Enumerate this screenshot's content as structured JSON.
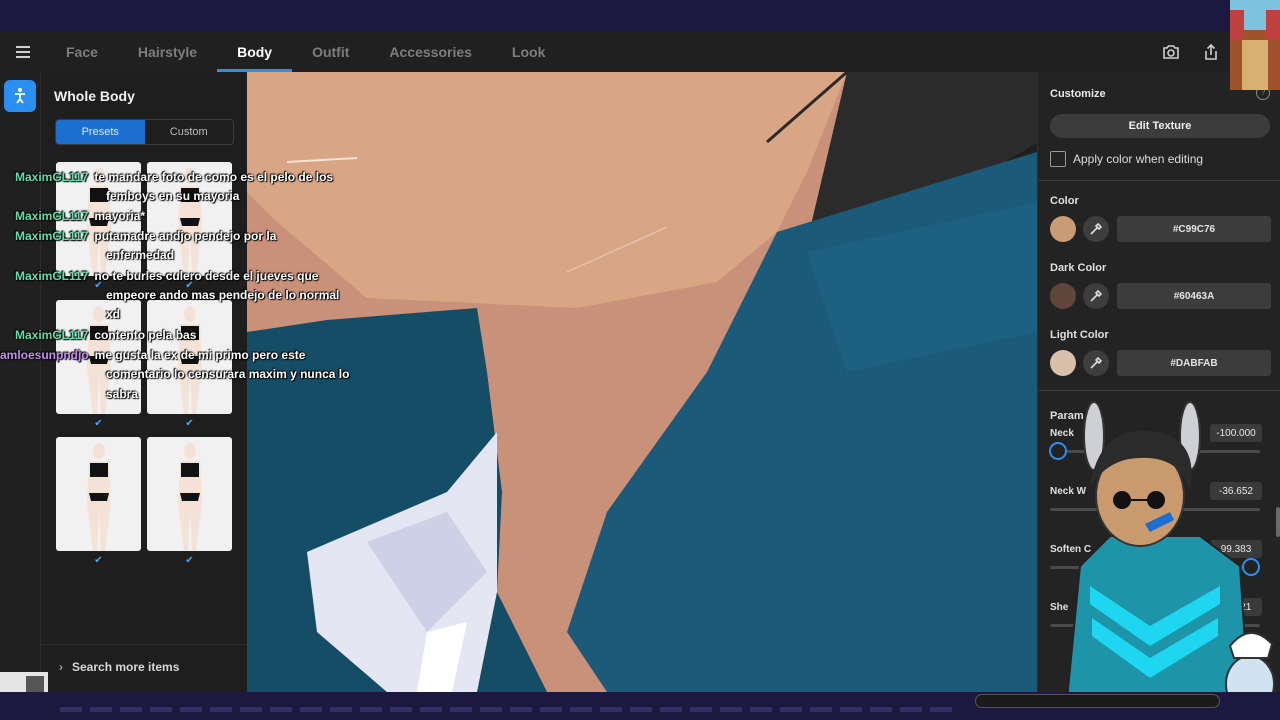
{
  "nav": {
    "tabs": [
      {
        "label": "Face",
        "active": false
      },
      {
        "label": "Hairstyle",
        "active": false
      },
      {
        "label": "Body",
        "active": true
      },
      {
        "label": "Outfit",
        "active": false
      },
      {
        "label": "Accessories",
        "active": false
      },
      {
        "label": "Look",
        "active": false
      }
    ],
    "icons": [
      "menu-icon",
      "camera-icon",
      "share-icon"
    ]
  },
  "left_panel": {
    "title": "Whole Body",
    "segments": [
      "Presets",
      "Custom"
    ],
    "active_segment": "Presets",
    "presets_count": 6,
    "search_more": "Search more items"
  },
  "right_panel": {
    "customize_title": "Customize",
    "edit_texture": "Edit Texture",
    "apply_color_label": "Apply color when editing",
    "apply_color_checked": false,
    "colors": [
      {
        "label": "Color",
        "hex": "#C99C76"
      },
      {
        "label": "Dark Color",
        "hex": "#60463A"
      },
      {
        "label": "Light Color",
        "hex": "#DABFAB"
      }
    ],
    "parameters_title": "Param",
    "params": [
      {
        "label": "Neck",
        "value": "-100.000"
      },
      {
        "label": "Neck W",
        "value": "-36.652"
      },
      {
        "label": "Soften C",
        "value": "99.383"
      },
      {
        "label": "She",
        "value": "53.921"
      }
    ]
  },
  "chat": [
    {
      "user": "MaximGL117",
      "text": "te mandare foto de como es el pelo de los",
      "user_color": "#5de0ad"
    },
    {
      "user": "",
      "text": "femboys en su mayoria",
      "user_color": ""
    },
    {
      "user": "MaximGL117",
      "text": "mayoria*",
      "user_color": "#5de0ad"
    },
    {
      "user": "MaximGL117",
      "text": "putamadre andjo pendejo por la",
      "user_color": "#5de0ad"
    },
    {
      "user": "",
      "text": "enfermedad",
      "user_color": ""
    },
    {
      "user": "MaximGL117",
      "text": "no te burles culero desde el jueves que",
      "user_color": "#5de0ad"
    },
    {
      "user": "",
      "text": "empeore ando mas pendejo de lo normal",
      "user_color": ""
    },
    {
      "user": "",
      "text": "xd",
      "user_color": ""
    },
    {
      "user": "MaximGL117",
      "text": "contento pela bas",
      "user_color": "#5de0ad"
    },
    {
      "user": "amloesunpndjo",
      "text": "me gusta la ex de mi primo pero este",
      "user_color": "#c78cf0"
    },
    {
      "user": "",
      "text": "comentario lo censurara maxim y nunca lo",
      "user_color": ""
    },
    {
      "user": "",
      "text": "sabra",
      "user_color": ""
    }
  ]
}
